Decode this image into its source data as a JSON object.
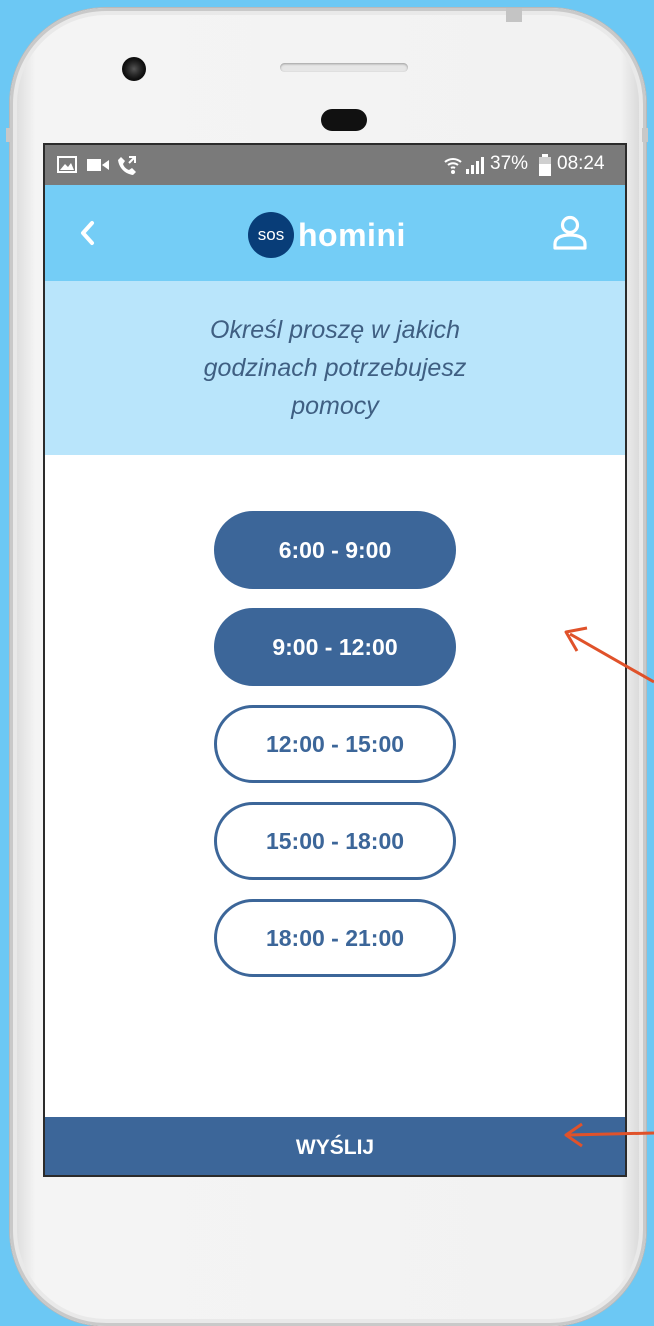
{
  "statusbar": {
    "left_icons": [
      "image-icon",
      "video-icon",
      "call-icon"
    ],
    "battery_percent": "37%",
    "time": "08:24"
  },
  "appbar": {
    "logo_badge": "sos",
    "logo_name": "homini"
  },
  "prompt": {
    "text": "Określ proszę w jakich godzinach potrzebujesz pomocy"
  },
  "time_slots": [
    {
      "label": "6:00 - 9:00",
      "selected": true
    },
    {
      "label": "9:00 - 12:00",
      "selected": true
    },
    {
      "label": "12:00 - 15:00",
      "selected": false
    },
    {
      "label": "15:00 - 18:00",
      "selected": false
    },
    {
      "label": "18:00 - 21:00",
      "selected": false
    }
  ],
  "submit": {
    "label": "WYŚLIJ"
  },
  "colors": {
    "background": "#6cc8f4",
    "appbar": "#74cdf6",
    "prompt_bg": "#b9e5fb",
    "primary": "#3c6699",
    "logo_circle": "#083d78",
    "annotation_arrow": "#e0522a"
  }
}
